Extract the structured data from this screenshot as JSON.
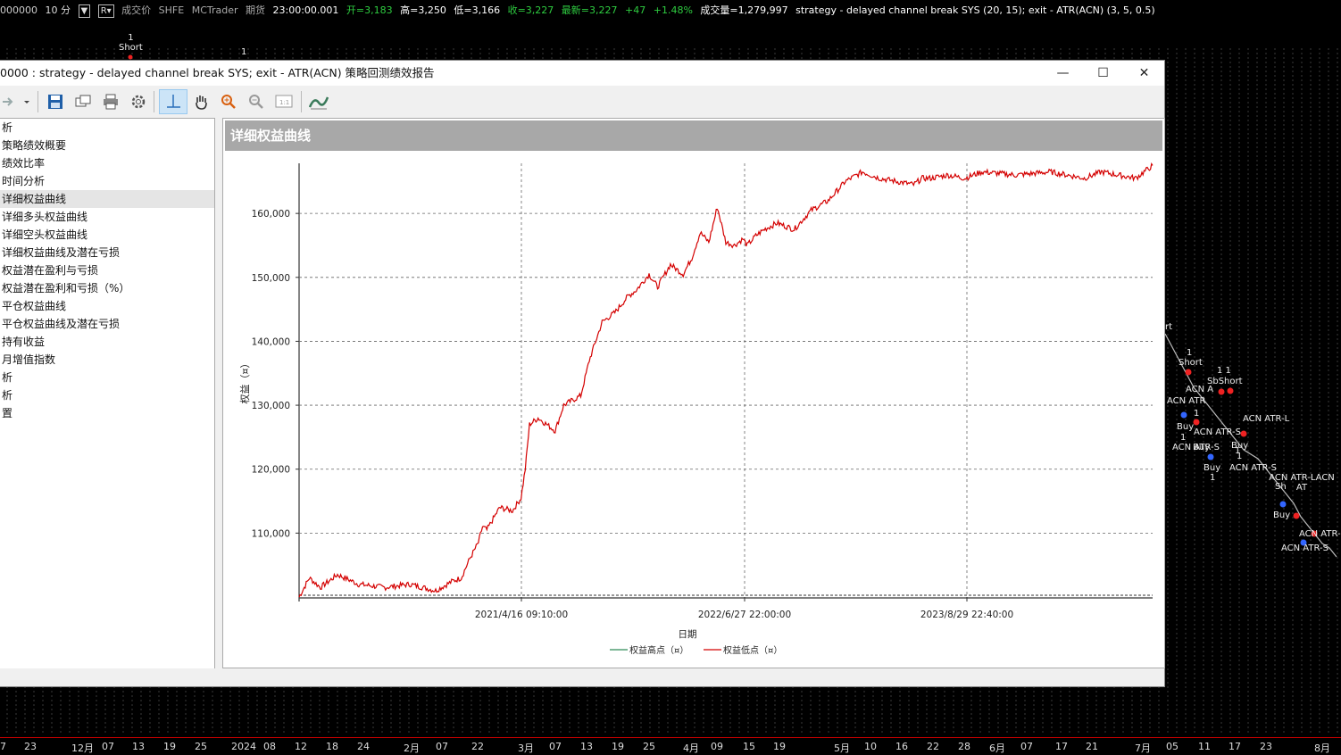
{
  "topbar": {
    "symbol": "000000",
    "interval": "10 分",
    "dropdown_btn": "▼",
    "r_btn": "R▾",
    "price_type": "成交价",
    "exchange": "SHFE",
    "source": "MCTrader",
    "category": "期货",
    "time": "23:00:00.001",
    "open": "开=3,183",
    "high": "高=3,250",
    "low": "低=3,166",
    "close": "收=3,227",
    "last": "最新=3,227",
    "change": "+47",
    "change_pct": "+1.48%",
    "volume": "成交量=1,279,997",
    "strategy": "strategy - delayed channel break SYS (20,  15); exit - ATR(ACN) (3,  5,  0.5)"
  },
  "bg_chart": {
    "top_marker": {
      "count": "1",
      "label": "Short"
    },
    "top_marker2": {
      "count": "1"
    },
    "labels": [
      "rt",
      "1",
      "Short",
      "1 1",
      "ACN A",
      "SbShort",
      "ACN ATR",
      "1",
      "Buy",
      "ACN ATR-S",
      "1",
      "Buy",
      "1",
      "ACN ATR-L",
      "Buy",
      "ACN ATR-S",
      "1",
      "Buy",
      "1",
      "ACN ATR-S",
      "ACN ATR-LACN AT",
      "Sh",
      "Buy",
      "ACN ATR-",
      "ACN ATR-S"
    ]
  },
  "date_axis": [
    "7",
    "23",
    "12月",
    "07",
    "13",
    "19",
    "25",
    "2024",
    "08",
    "12",
    "18",
    "24",
    "2月",
    "07",
    "22",
    "3月",
    "07",
    "13",
    "19",
    "25",
    "4月",
    "09",
    "15",
    "19",
    "5月",
    "10",
    "16",
    "22",
    "28",
    "6月",
    "07",
    "17",
    "21",
    "7月",
    "05",
    "11",
    "17",
    "23",
    "8月"
  ],
  "window": {
    "title": "0000 : strategy - delayed channel break SYS; exit - ATR(ACN) 策略回测绩效报告",
    "minimize": "—",
    "maximize": "☐",
    "close": "✕"
  },
  "toolbar": {
    "icons": [
      "forward-arrow-icon",
      "dropdown-arrow-icon",
      "save-icon",
      "copy-icon",
      "print-icon",
      "settings-gear-icon",
      "crosshair-icon",
      "hand-pan-icon",
      "zoom-in-icon",
      "zoom-out-icon",
      "zoom-reset-icon",
      "chart-wave-icon"
    ]
  },
  "tree": {
    "items": [
      {
        "label": "析",
        "selected": false
      },
      {
        "label": "策略绩效概要",
        "selected": false
      },
      {
        "label": "绩效比率",
        "selected": false
      },
      {
        "label": "时间分析",
        "selected": false
      },
      {
        "label": "详细权益曲线",
        "selected": true
      },
      {
        "label": "详细多头权益曲线",
        "selected": false
      },
      {
        "label": "详细空头权益曲线",
        "selected": false
      },
      {
        "label": "详细权益曲线及潜在亏损",
        "selected": false
      },
      {
        "label": "权益潜在盈利与亏损",
        "selected": false
      },
      {
        "label": "权益潜在盈利和亏损（%）",
        "selected": false
      },
      {
        "label": "平仓权益曲线",
        "selected": false
      },
      {
        "label": "平仓权益曲线及潜在亏损",
        "selected": false
      },
      {
        "label": "持有收益",
        "selected": false
      },
      {
        "label": "月增值指数",
        "selected": false
      },
      {
        "label": "析",
        "selected": false
      },
      {
        "label": "析",
        "selected": false
      },
      {
        "label": "置",
        "selected": false
      }
    ]
  },
  "panel": {
    "header": "详细权益曲线"
  },
  "chart_data": {
    "type": "line",
    "title": "",
    "xlabel": "日期",
    "ylabel": "权益（¤）",
    "x_ticks": [
      "2021/4/16 09:10:00",
      "2022/6/27 22:00:00",
      "2023/8/29 22:40:00"
    ],
    "y_ticks": [
      "110,000",
      "120,000",
      "130,000",
      "140,000",
      "150,000",
      "160,000"
    ],
    "ylim": [
      100000,
      167000
    ],
    "grid": true,
    "legend_position": "bottom",
    "series": [
      {
        "name": "权益高点（¤）",
        "color": "#2e8b57",
        "values": []
      },
      {
        "name": "权益低点（¤）",
        "color": "#d40000",
        "x_fraction": [
          0,
          0.012,
          0.025,
          0.045,
          0.07,
          0.1,
          0.13,
          0.16,
          0.18,
          0.19,
          0.2,
          0.21,
          0.215,
          0.22,
          0.235,
          0.25,
          0.26,
          0.265,
          0.27,
          0.28,
          0.29,
          0.3,
          0.31,
          0.33,
          0.34,
          0.355,
          0.37,
          0.385,
          0.395,
          0.41,
          0.42,
          0.435,
          0.45,
          0.46,
          0.47,
          0.48,
          0.49,
          0.5,
          0.51,
          0.52,
          0.525,
          0.535,
          0.545,
          0.56,
          0.58,
          0.6,
          0.62,
          0.64,
          0.66,
          0.68,
          0.7,
          0.72,
          0.73,
          0.74,
          0.76,
          0.78,
          0.8,
          0.84,
          0.88,
          0.92,
          0.94,
          0.96,
          0.98,
          1.0
        ],
        "values": [
          100000,
          103000,
          101500,
          103500,
          102000,
          101500,
          102000,
          101000,
          102500,
          103000,
          106000,
          108500,
          111000,
          110500,
          114000,
          113500,
          115500,
          120000,
          127000,
          128000,
          127000,
          126000,
          130000,
          131500,
          137000,
          143000,
          144500,
          147000,
          148000,
          150500,
          148500,
          152000,
          150500,
          153000,
          157000,
          155500,
          161000,
          155500,
          155000,
          156000,
          155000,
          156500,
          157500,
          158500,
          157500,
          160500,
          162000,
          165000,
          166500,
          165500,
          165000,
          164500,
          165500,
          165500,
          166000,
          165500,
          166500,
          166000,
          166500,
          165500,
          166500,
          166000,
          165500,
          167500
        ]
      }
    ]
  }
}
